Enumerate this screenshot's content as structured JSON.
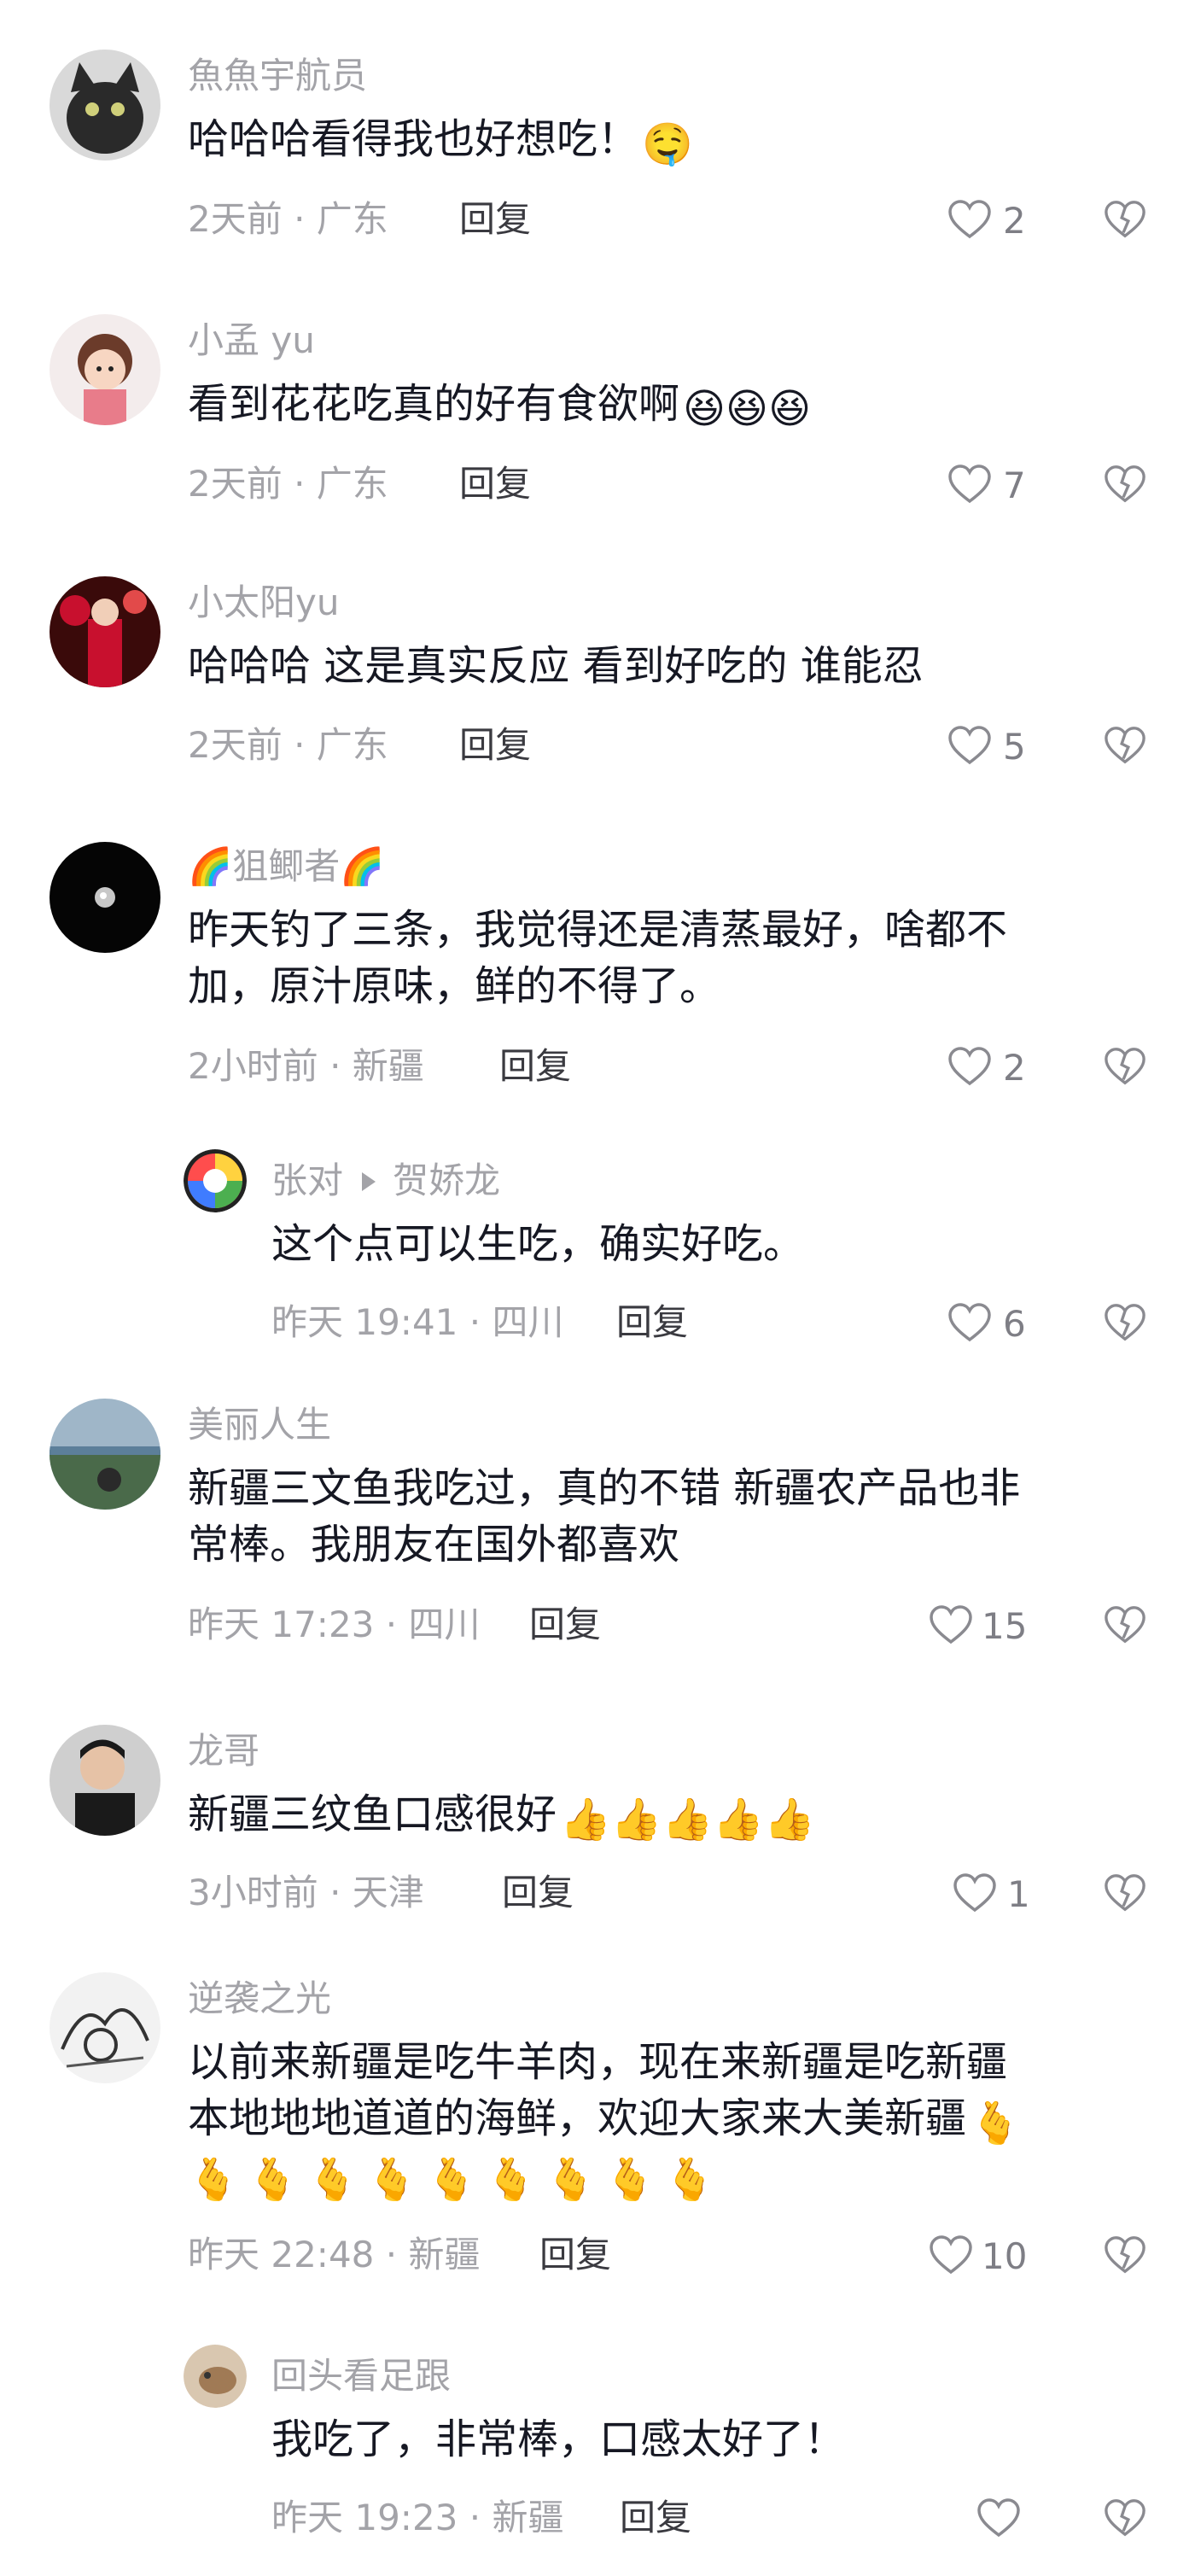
{
  "comments": [
    {
      "name": "魚魚宇航员",
      "text": "哈哈哈看得我也好想吃！",
      "time": "2天前 · 广东",
      "reply": "回复",
      "likes": "2",
      "emoji": "🤤"
    },
    {
      "name": "小孟 yu",
      "text": "看到花花吃真的好有食欲啊",
      "time": "2天前 · 广东",
      "reply": "回复",
      "likes": "7",
      "emoji": "😆😆😆"
    },
    {
      "name": "小太阳yu",
      "text": "哈哈哈 这是真实反应 看到好吃的 谁能忍",
      "time": "2天前 · 广东",
      "reply": "回复",
      "likes": "5"
    },
    {
      "name": "🌈狙鲫者🌈",
      "text": "昨天钓了三条，我觉得还是清蒸最好，啥都不",
      "text2": "加，原汁原味，鲜的不得了。",
      "time": "2小时前 · 新疆",
      "reply": "回复",
      "likes": "2"
    },
    {
      "name": "张对",
      "reply_to": "贺娇龙",
      "text": "这个点可以生吃，确实好吃。",
      "time": "昨天 19:41 · 四川",
      "reply": "回复",
      "likes": "6"
    },
    {
      "name": "美丽人生",
      "text": "新疆三文鱼我吃过，真的不错 新疆农产品也非",
      "text2": "常棒。我朋友在国外都喜欢",
      "time": "昨天 17:23 · 四川",
      "reply": "回复",
      "likes": "15"
    },
    {
      "name": "龙哥",
      "text": "新疆三纹鱼口感很好",
      "time": "3小时前 · 天津",
      "reply": "回复",
      "likes": "1",
      "emoji": "👍👍👍👍👍"
    },
    {
      "name": "逆袭之光",
      "text": "以前来新疆是吃牛羊肉，现在来新疆是吃新疆",
      "text2": "本地地地道道的海鲜，欢迎大家来大美新疆",
      "emoji": "🫰",
      "emoji_line": "🫰🫰🫰🫰🫰🫰🫰🫰🫰",
      "time": "昨天 22:48 · 新疆",
      "reply": "回复",
      "likes": "10"
    },
    {
      "name": "回头看足跟",
      "text": "我吃了，非常棒，口感太好了！",
      "time": "昨天 19:23 · 新疆",
      "reply": "回复",
      "likes": ""
    }
  ],
  "colors": {
    "text": "#161823",
    "meta": "#a3a3a8",
    "reply": "#3a3a40",
    "icon": "#8a8a90"
  }
}
